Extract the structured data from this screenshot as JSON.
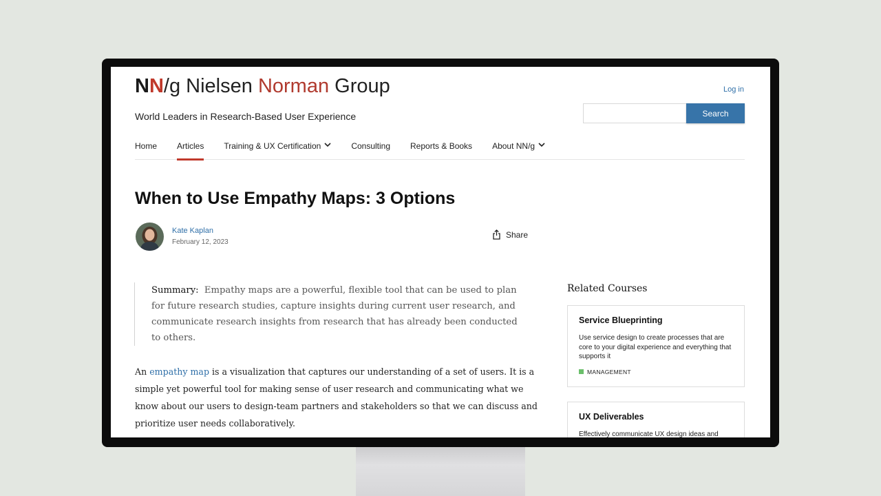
{
  "logo": {
    "mark_n1": "N",
    "mark_n2": "N",
    "mark_slash_g": "/g",
    "word1": "Nielsen",
    "word2": "Norman",
    "word3": "Group"
  },
  "tagline": "World Leaders in Research-Based User Experience",
  "header": {
    "login": "Log in",
    "search_button": "Search",
    "search_placeholder": ""
  },
  "nav": {
    "items": [
      {
        "label": "Home"
      },
      {
        "label": "Articles"
      },
      {
        "label": "Training & UX Certification"
      },
      {
        "label": "Consulting"
      },
      {
        "label": "Reports & Books"
      },
      {
        "label": "About NN/g"
      }
    ],
    "active": "Articles"
  },
  "article": {
    "title": "When to Use Empathy Maps: 3 Options",
    "author": "Kate Kaplan",
    "date": "February 12, 2023",
    "share_label": "Share",
    "summary_label": "Summary:",
    "summary_text": "Empathy maps are a powerful, flexible tool that can be used to plan for future research studies, capture insights during current user research, and communicate research insights from research that has already been conducted to others.",
    "body_intro": "An",
    "body_link": "empathy map",
    "body_rest": "is a visualization that captures our understanding of a set of users. It is a simple yet powerful tool for making sense of user research and communicating what we know about our users to design-team partners and stakeholders so that we can discuss and prioritize user needs collaboratively."
  },
  "related": {
    "title": "Related Courses",
    "courses": [
      {
        "title": "Service Blueprinting",
        "description": "Use service design to create processes that are core to your digital experience and everything that supports it",
        "tag": "MANAGEMENT",
        "tag_color": "#6bbf6b"
      },
      {
        "title": "UX Deliverables",
        "description": "Effectively communicate UX design ideas and"
      }
    ]
  },
  "colors": {
    "accent_red": "#c0392b",
    "link_blue": "#2f6fa8",
    "button_blue": "#3774a9"
  }
}
